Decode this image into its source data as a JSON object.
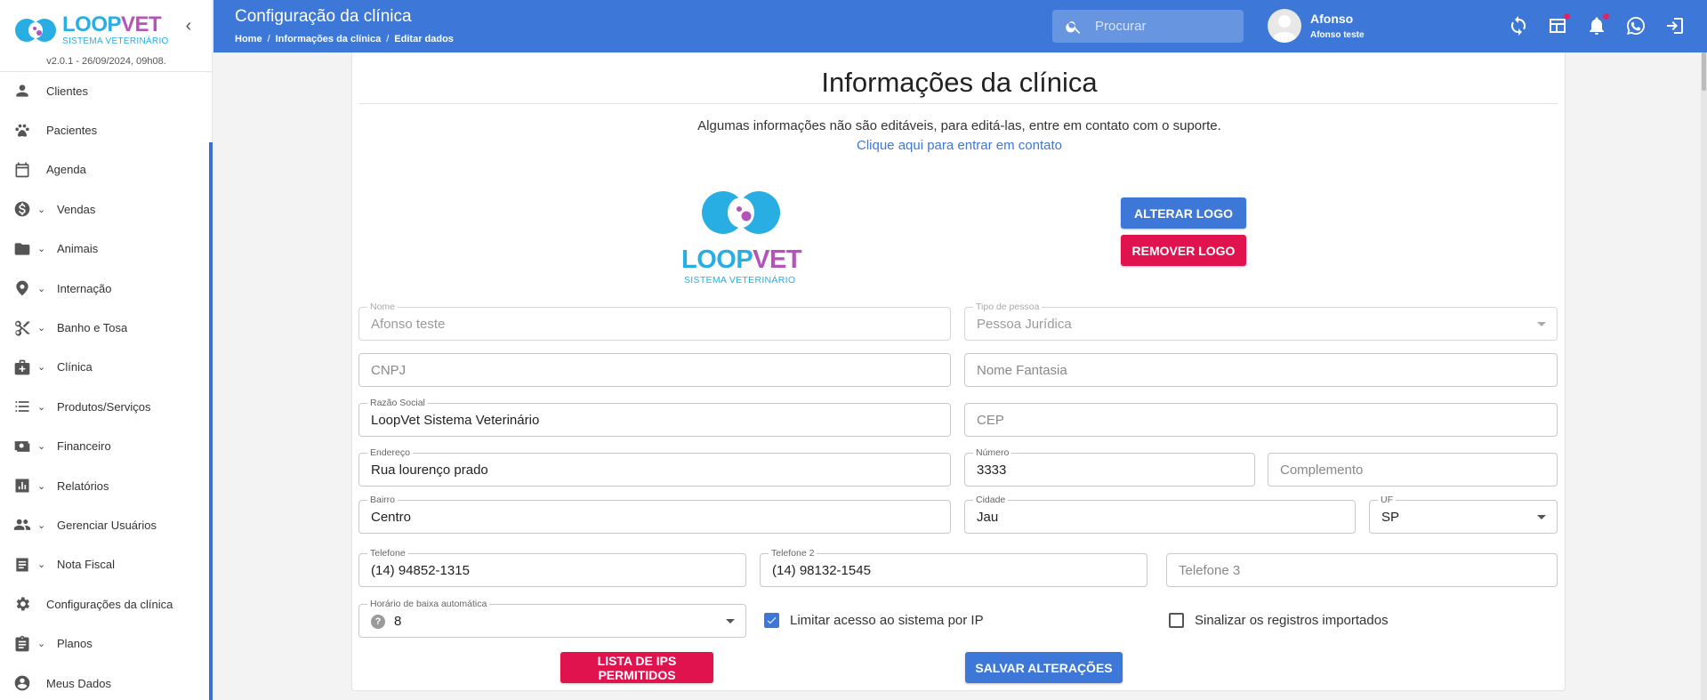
{
  "sidebar": {
    "brand": {
      "loop": "LOOP",
      "vet": "VET",
      "tagline": "SISTEMA VETERINÁRIO"
    },
    "version": "v2.0.1 - 26/09/2024, 09h08.",
    "items": [
      {
        "label": "Clientes",
        "icon": "person-icon"
      },
      {
        "label": "Pacientes",
        "icon": "paw-icon"
      },
      {
        "label": "Agenda",
        "icon": "calendar-icon"
      },
      {
        "label": "Vendas",
        "icon": "dollar-icon"
      },
      {
        "label": "Animais",
        "icon": "folder-icon"
      },
      {
        "label": "Internação",
        "icon": "location-pin-icon"
      },
      {
        "label": "Banho e Tosa",
        "icon": "scissors-icon"
      },
      {
        "label": "Clínica",
        "icon": "medical-kit-icon"
      },
      {
        "label": "Produtos/Serviços",
        "icon": "list-icon"
      },
      {
        "label": "Financeiro",
        "icon": "money-icon"
      },
      {
        "label": "Relatórios",
        "icon": "bar-chart-icon"
      },
      {
        "label": "Gerenciar Usuários",
        "icon": "people-icon"
      },
      {
        "label": "Nota Fiscal",
        "icon": "receipt-icon"
      },
      {
        "label": "Configurações da clínica",
        "icon": "gear-icon"
      },
      {
        "label": "Planos",
        "icon": "clipboard-icon"
      },
      {
        "label": "Meus Dados",
        "icon": "account-circle-icon"
      }
    ]
  },
  "header": {
    "title": "Configuração da clínica",
    "breadcrumb": [
      "Home",
      "Informações da clínica",
      "Editar dados"
    ],
    "search_placeholder": "Procurar",
    "user_name": "Afonso",
    "user_sub": "Afonso teste"
  },
  "main": {
    "title": "Informações da clínica",
    "notice": "Algumas informações não são editáveis, para editá-las, entre em contato com o suporte.",
    "contact_link": "Clique aqui para entrar em contato",
    "logo": {
      "loop": "LOOP",
      "vet": "VET",
      "tagline": "SISTEMA VETERINÁRIO"
    },
    "change_logo": "ALTERAR LOGO",
    "remove_logo": "REMOVER LOGO",
    "form": {
      "nome": {
        "label": "Nome",
        "value": "Afonso teste"
      },
      "tipo_pessoa": {
        "label": "Tipo de pessoa",
        "value": "Pessoa Jurídica"
      },
      "cnpj": {
        "placeholder": "CNPJ"
      },
      "nome_fantasia": {
        "placeholder": "Nome Fantasia"
      },
      "razao_social": {
        "label": "Razão Social",
        "value": "LoopVet Sistema Veterinário"
      },
      "cep": {
        "placeholder": "CEP"
      },
      "endereco": {
        "label": "Endereço",
        "value": "Rua lourenço prado"
      },
      "numero": {
        "label": "Número",
        "value": "3333"
      },
      "complemento": {
        "placeholder": "Complemento"
      },
      "bairro": {
        "label": "Bairro",
        "value": "Centro"
      },
      "cidade": {
        "label": "Cidade",
        "value": "Jau"
      },
      "uf": {
        "label": "UF",
        "value": "SP"
      },
      "telefone": {
        "label": "Telefone",
        "value": "(14) 94852-1315"
      },
      "telefone2": {
        "label": "Telefone 2",
        "value": "(14) 98132-1545"
      },
      "telefone3": {
        "placeholder": "Telefone 3"
      },
      "horario": {
        "label": "Horário de baixa automática",
        "value": "8"
      },
      "limitar_ip": {
        "label": "Limitar acesso ao sistema por IP",
        "checked": true
      },
      "sinalizar": {
        "label": "Sinalizar os registros importados",
        "checked": false
      }
    },
    "ips_button": "LISTA DE IPS PERMITIDOS",
    "save_button": "SALVAR ALTERAÇÕES"
  },
  "colors": {
    "primary": "#3d78d8",
    "danger": "#e0134f",
    "brand_blue": "#29aee3",
    "brand_purple": "#b454b8"
  }
}
